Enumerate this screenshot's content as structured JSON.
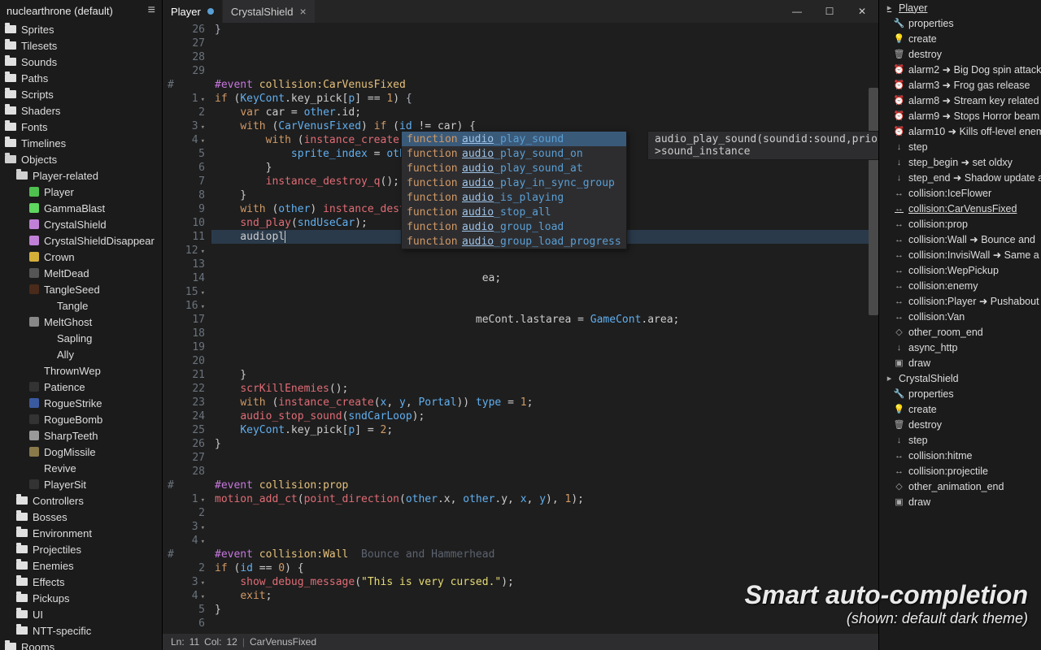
{
  "project_title": "nuclearthrone (default)",
  "sidebar": {
    "tree": [
      {
        "label": "Sprites",
        "icon": "folder",
        "ind": 0
      },
      {
        "label": "Tilesets",
        "icon": "folder",
        "ind": 0
      },
      {
        "label": "Sounds",
        "icon": "folder",
        "ind": 0
      },
      {
        "label": "Paths",
        "icon": "folder",
        "ind": 0
      },
      {
        "label": "Scripts",
        "icon": "folder",
        "ind": 0
      },
      {
        "label": "Shaders",
        "icon": "folder",
        "ind": 0
      },
      {
        "label": "Fonts",
        "icon": "folder",
        "ind": 0
      },
      {
        "label": "Timelines",
        "icon": "folder",
        "ind": 0
      },
      {
        "label": "Objects",
        "icon": "folder-open",
        "ind": 0
      },
      {
        "label": "Player-related",
        "icon": "folder-open",
        "ind": 1
      },
      {
        "label": "Player",
        "icon": "obj",
        "color": "#4fc14f",
        "ind": 2
      },
      {
        "label": "GammaBlast",
        "icon": "obj",
        "color": "#5fd65f",
        "ind": 2
      },
      {
        "label": "CrystalShield",
        "icon": "obj",
        "color": "#c080d8",
        "ind": 2
      },
      {
        "label": "CrystalShieldDisappear",
        "icon": "obj",
        "color": "#c080d8",
        "ind": 2
      },
      {
        "label": "Crown",
        "icon": "obj",
        "color": "#d4b038",
        "ind": 2
      },
      {
        "label": "MeltDead",
        "icon": "obj",
        "color": "#555",
        "ind": 2
      },
      {
        "label": "TangleSeed",
        "icon": "obj",
        "color": "#4a2a1a",
        "ind": 2
      },
      {
        "label": "Tangle",
        "icon": "obj",
        "color": "transparent",
        "ind": 3
      },
      {
        "label": "MeltGhost",
        "icon": "obj",
        "color": "#888",
        "ind": 2
      },
      {
        "label": "Sapling",
        "icon": "obj",
        "color": "transparent",
        "ind": 3
      },
      {
        "label": "Ally",
        "icon": "obj",
        "color": "transparent",
        "ind": 3
      },
      {
        "label": "ThrownWep",
        "icon": "obj",
        "color": "transparent",
        "ind": 2
      },
      {
        "label": "Patience",
        "icon": "obj",
        "color": "#333",
        "ind": 2
      },
      {
        "label": "RogueStrike",
        "icon": "obj",
        "color": "#3a5aa0",
        "ind": 2
      },
      {
        "label": "RogueBomb",
        "icon": "obj",
        "color": "#333",
        "ind": 2
      },
      {
        "label": "SharpTeeth",
        "icon": "obj",
        "color": "#999",
        "ind": 2
      },
      {
        "label": "DogMissile",
        "icon": "obj",
        "color": "#8a7a4a",
        "ind": 2
      },
      {
        "label": "Revive",
        "icon": "obj",
        "color": "transparent",
        "ind": 2
      },
      {
        "label": "PlayerSit",
        "icon": "obj",
        "color": "#333",
        "ind": 2
      },
      {
        "label": "Controllers",
        "icon": "folder",
        "ind": 1
      },
      {
        "label": "Bosses",
        "icon": "folder",
        "ind": 1
      },
      {
        "label": "Environment",
        "icon": "folder",
        "ind": 1
      },
      {
        "label": "Projectiles",
        "icon": "folder",
        "ind": 1
      },
      {
        "label": "Enemies",
        "icon": "folder",
        "ind": 1
      },
      {
        "label": "Effects",
        "icon": "folder",
        "ind": 1
      },
      {
        "label": "Pickups",
        "icon": "folder",
        "ind": 1
      },
      {
        "label": "UI",
        "icon": "folder",
        "ind": 1
      },
      {
        "label": "NTT-specific",
        "icon": "folder",
        "ind": 1
      },
      {
        "label": "Rooms",
        "icon": "folder",
        "ind": 0
      }
    ]
  },
  "tabs": [
    {
      "label": "Player",
      "modified": true,
      "active": true
    },
    {
      "label": "CrystalShield",
      "modified": false,
      "active": false
    }
  ],
  "autocomplete": {
    "signature": "audio_play_sound(soundid:sound,priority:int,loops:bool)->sound_instance",
    "items": [
      {
        "type": "function",
        "name": "audio_play_sound",
        "sel": true
      },
      {
        "type": "function",
        "name": "audio_play_sound_on"
      },
      {
        "type": "function",
        "name": "audio_play_sound_at"
      },
      {
        "type": "function",
        "name": "audio_play_in_sync_group"
      },
      {
        "type": "function",
        "name": "audio_is_playing"
      },
      {
        "type": "function",
        "name": "audio_stop_all"
      },
      {
        "type": "function",
        "name": "audio_group_load"
      },
      {
        "type": "function",
        "name": "audio_group_load_progress"
      }
    ]
  },
  "gutter": {
    "top": [
      {
        "n": "26",
        "f": 1
      },
      {
        "n": "27"
      },
      {
        "n": "28"
      },
      {
        "n": "29"
      }
    ],
    "block1": [
      "#",
      "1",
      "2",
      "3",
      "4",
      "5",
      "6",
      "7",
      "8",
      "9",
      "10",
      "11",
      "12",
      "13",
      "14",
      "15",
      "16",
      "17",
      "18",
      "19",
      "20",
      "21",
      "22",
      "23",
      "24",
      "25",
      "26",
      "27",
      "28"
    ],
    "block2": [
      "#",
      "1",
      "2",
      "3",
      "4"
    ],
    "block3": [
      "#",
      "2",
      "3",
      "4",
      "5",
      "6"
    ]
  },
  "code_typed": "audiopl",
  "outline": [
    {
      "label": "Player",
      "icon": "▸",
      "ind": 0,
      "und": true
    },
    {
      "label": "properties",
      "icon": "🔧",
      "ind": 1
    },
    {
      "label": "create",
      "icon": "💡",
      "ind": 1
    },
    {
      "label": "destroy",
      "icon": "🗑",
      "ind": 1
    },
    {
      "label": "alarm2 ➜ Big Dog spin attack",
      "icon": "⏰",
      "ind": 1
    },
    {
      "label": "alarm3 ➜ Frog gas release",
      "icon": "⏰",
      "ind": 1
    },
    {
      "label": "alarm8 ➜ Stream key related",
      "icon": "⏰",
      "ind": 1
    },
    {
      "label": "alarm9 ➜ Stops Horror beam",
      "icon": "⏰",
      "ind": 1
    },
    {
      "label": "alarm10 ➜ Kills off-level enem",
      "icon": "⏰",
      "ind": 1
    },
    {
      "label": "step",
      "icon": "↓",
      "ind": 1
    },
    {
      "label": "step_begin ➜ set oldxy",
      "icon": "↓",
      "ind": 1
    },
    {
      "label": "step_end ➜ Shadow update a",
      "icon": "↓",
      "ind": 1
    },
    {
      "label": "collision:IceFlower",
      "icon": "↔",
      "ind": 1
    },
    {
      "label": "collision:CarVenusFixed",
      "icon": "↔",
      "ind": 1,
      "und": true
    },
    {
      "label": "collision:prop",
      "icon": "↔",
      "ind": 1
    },
    {
      "label": "collision:Wall ➜ Bounce and",
      "icon": "↔",
      "ind": 1
    },
    {
      "label": "collision:InvisiWall ➜ Same a",
      "icon": "↔",
      "ind": 1
    },
    {
      "label": "collision:WepPickup",
      "icon": "↔",
      "ind": 1
    },
    {
      "label": "collision:enemy",
      "icon": "↔",
      "ind": 1
    },
    {
      "label": "collision:Player ➜ Pushabout",
      "icon": "↔",
      "ind": 1
    },
    {
      "label": "collision:Van",
      "icon": "↔",
      "ind": 1
    },
    {
      "label": "other_room_end",
      "icon": "◇",
      "ind": 1
    },
    {
      "label": "async_http",
      "icon": "↓",
      "ind": 1
    },
    {
      "label": "draw",
      "icon": "▣",
      "ind": 1
    },
    {
      "label": "CrystalShield",
      "icon": "▸",
      "ind": 0
    },
    {
      "label": "properties",
      "icon": "🔧",
      "ind": 1
    },
    {
      "label": "create",
      "icon": "💡",
      "ind": 1
    },
    {
      "label": "destroy",
      "icon": "🗑",
      "ind": 1
    },
    {
      "label": "step",
      "icon": "↓",
      "ind": 1
    },
    {
      "label": "collision:hitme",
      "icon": "↔",
      "ind": 1
    },
    {
      "label": "collision:projectile",
      "icon": "↔",
      "ind": 1
    },
    {
      "label": "other_animation_end",
      "icon": "◇",
      "ind": 1
    },
    {
      "label": "draw",
      "icon": "▣",
      "ind": 1
    }
  ],
  "status": {
    "ln_label": "Ln:",
    "ln": "11",
    "col_label": "Col:",
    "col": "12",
    "context": "CarVenusFixed"
  },
  "overlay": {
    "big": "Smart auto-completion",
    "small": "(shown: default dark theme)"
  }
}
